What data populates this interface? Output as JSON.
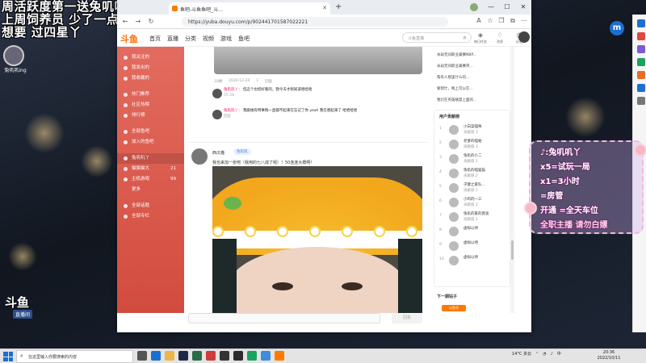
{
  "overlay_top_left": {
    "lines": [
      "周活跃度第一送兔叽叽小饼干哦",
      "上周饲养员 少了一点 坚决",
      "想要 过四星丫"
    ],
    "logo_caption": "兔叽叽ing"
  },
  "browser": {
    "tab_title": "鱼吧-斗鱼鱼吧_斗...",
    "url": "https://yuba.douyu.com/p/902441701587022221"
  },
  "douyu": {
    "logo": "斗鱼",
    "nav": [
      "首页",
      "直播",
      "分类",
      "视频",
      "游戏",
      "鱼吧"
    ],
    "search_placeholder": "斗鱼直播",
    "header_icons": [
      {
        "name": "task-icon",
        "label": "每日任务"
      },
      {
        "name": "notify-icon",
        "label": "消息"
      },
      {
        "name": "history-icon",
        "label": "历史"
      }
    ]
  },
  "sidebar": {
    "items": [
      {
        "label": "我关注的",
        "count": ""
      },
      {
        "label": "我发出的",
        "count": ""
      },
      {
        "label": "我收藏的",
        "count": ""
      },
      {
        "label": "热门推荐",
        "count": ""
      },
      {
        "label": "社区热榜",
        "count": ""
      },
      {
        "label": "排行榜",
        "count": ""
      },
      {
        "label": "全部鱼吧",
        "count": ""
      },
      {
        "label": "加入的鱼吧",
        "count": ""
      },
      {
        "label": "兔叽叽丫",
        "count": ""
      },
      {
        "label": "猫猫猫大",
        "count": "21"
      },
      {
        "label": "主机游戏",
        "count": "99"
      },
      {
        "label": "更多",
        "count": ""
      },
      {
        "label": "全部话题",
        "count": ""
      },
      {
        "label": "全部专栏",
        "count": ""
      }
    ]
  },
  "main": {
    "post_meta": [
      "10楼",
      "2020-12-20",
      "1",
      "回复"
    ],
    "comments": [
      {
        "user": "兔叽叽丫：",
        "text": "但这个也挺好看的，我今天才刚知道哈哈哈",
        "time": "05-28"
      },
      {
        "user": "兔叽叽丫：",
        "text": "我跟谁有特事情一直都不起来在忘记了你 yeah 我在想起来了 哈哈哈哈",
        "time": "回复"
      }
    ],
    "post2_user": "西瓜猫",
    "post2_tag": "兔叽叽",
    "post2_text": "我也来加一张吧（我用的七八成了呢）！50连连大概啊！",
    "reply_button": "回复"
  },
  "right_sidebar": {
    "top_list": [
      "永劫无间职业兼赛NBP...",
      "永劫无间职业兼赛突...",
      "帮有人那里什么的...",
      "要帮忙，晚上可以在...",
      "我们在英雄联盟上面的..."
    ],
    "ranking_title": "用户贡献榜",
    "rankings": [
      {
        "num": "1",
        "name": "小白菜喵咪",
        "sub": "贡献值 3"
      },
      {
        "num": "2",
        "name": "老爹的喵帕",
        "sub": "贡献值 3"
      },
      {
        "num": "3",
        "name": "兔叽的小二",
        "sub": "贡献值 2"
      },
      {
        "num": "4",
        "name": "兔叽的喵猫猫",
        "sub": "贡献值 2"
      },
      {
        "num": "5",
        "name": "子健之家队...",
        "sub": "贡献值 2"
      },
      {
        "num": "6",
        "name": "小鸡的一三",
        "sub": "贡献值 2"
      },
      {
        "num": "7",
        "name": "兔叽的家的莫谈",
        "sub": "贡献值 2"
      },
      {
        "num": "8",
        "name": "虚拟以待",
        "sub": ""
      },
      {
        "num": "9",
        "name": "虚拟以待",
        "sub": ""
      },
      {
        "num": "10",
        "name": "虚拟以待",
        "sub": ""
      }
    ],
    "more_title": "下一期站子",
    "more_button": "斗鱼号"
  },
  "overlay_right": {
    "m_badge": "m",
    "lines": [
      "♪:兔叽叽丫",
      "x5=试玩一局",
      "x1=3小时",
      "=房管",
      "开通 =全天车位",
      "全职主播 请勿白嫖"
    ]
  },
  "watermark": {
    "main": "斗鱼",
    "sub": "直播间"
  },
  "taskbar": {
    "search_placeholder": "在这里输入你要搜索的内容",
    "weather": "14°C 多云",
    "time": "20:36",
    "date": "2022/10/11",
    "ime": "中"
  }
}
